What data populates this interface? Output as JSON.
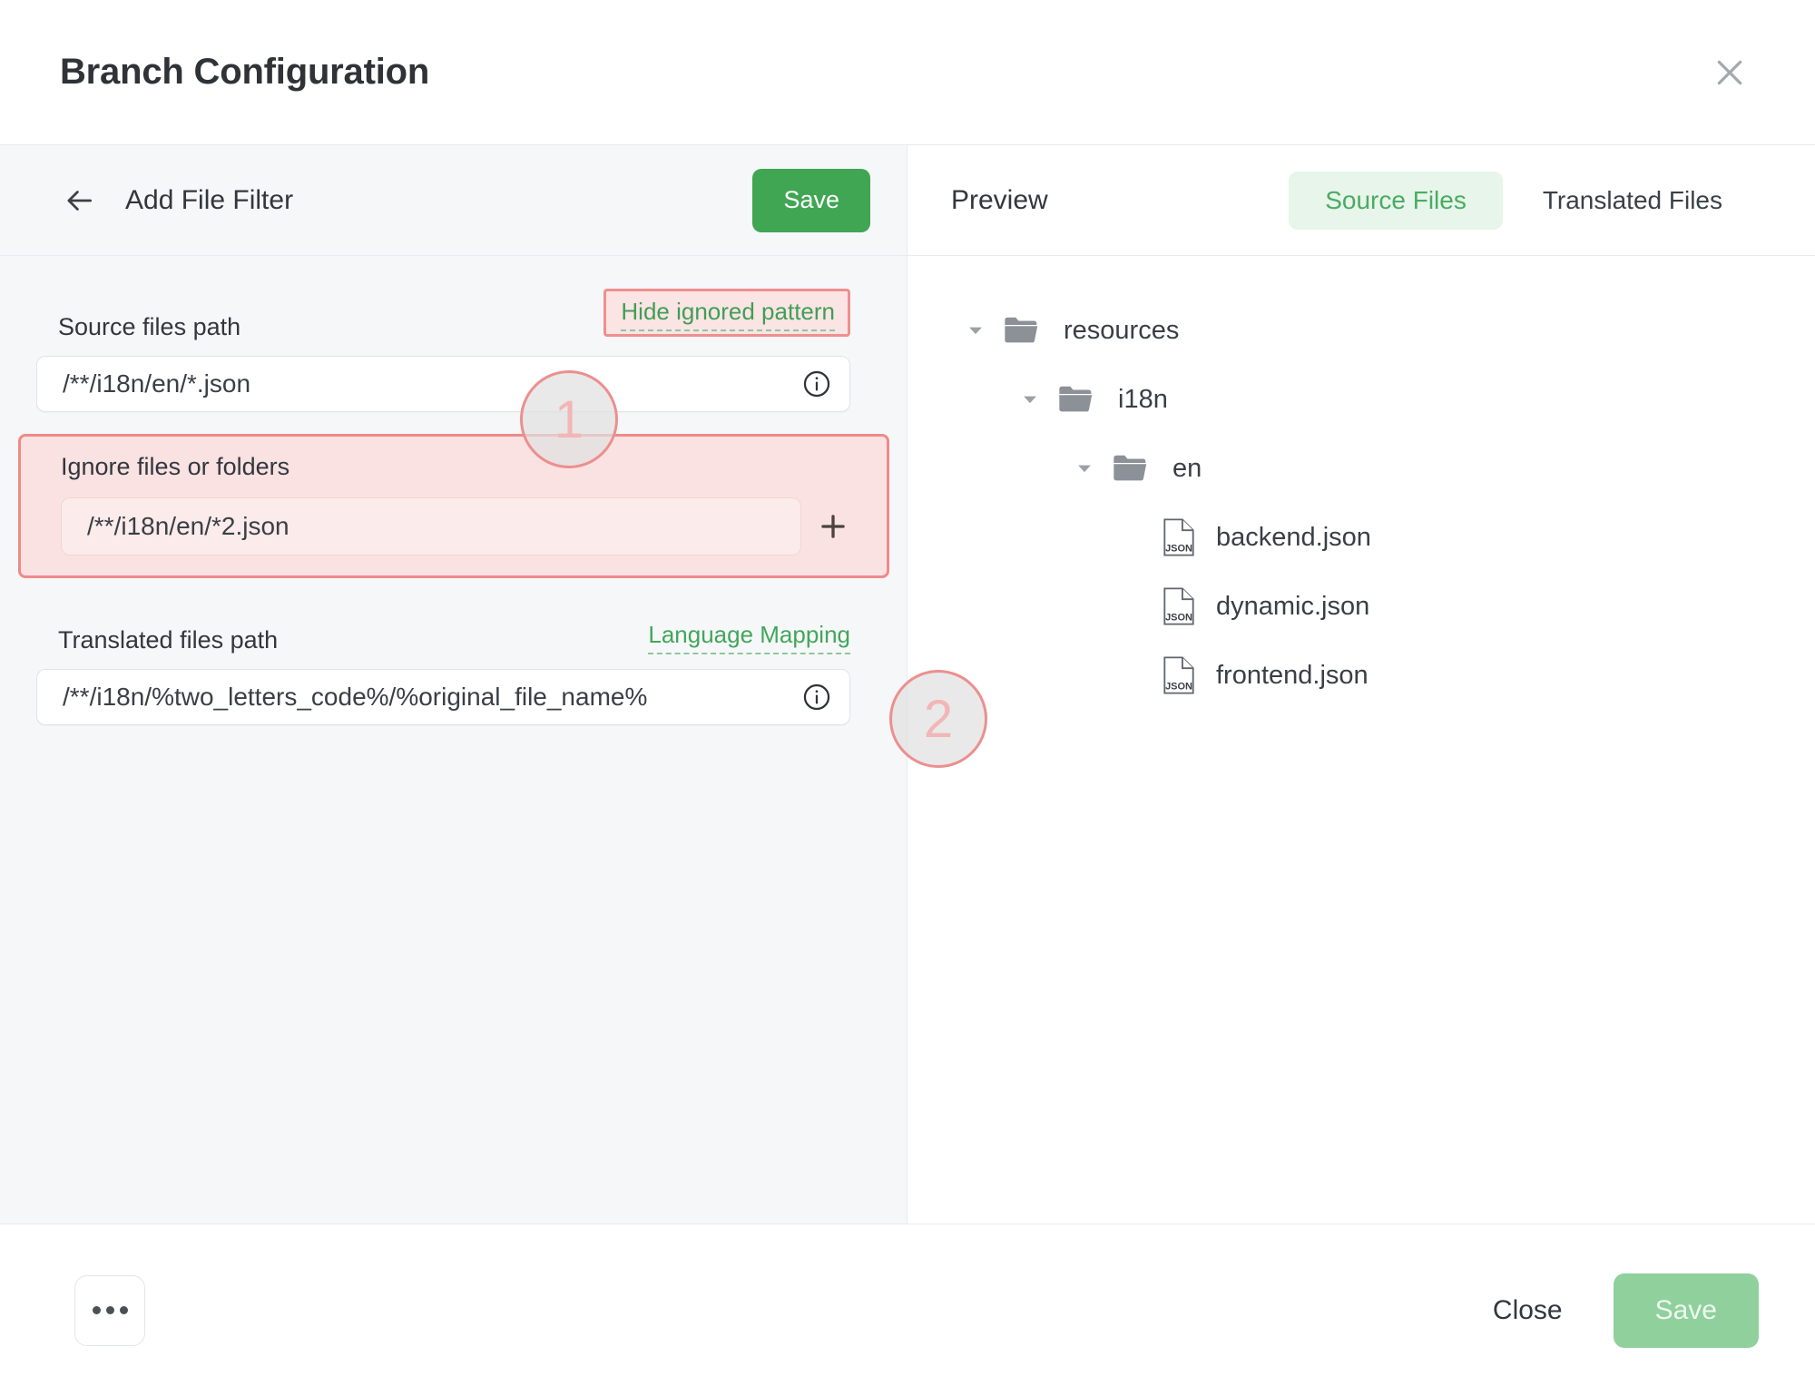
{
  "header": {
    "title": "Branch Configuration",
    "close_icon": "close-icon"
  },
  "left_panel": {
    "back_icon": "arrow-left-icon",
    "subtitle": "Add File Filter",
    "save_label": "Save",
    "source_files": {
      "label": "Source files path",
      "toggle_link": "Hide ignored pattern",
      "value": "/**/i18n/en/*.json",
      "info_icon": "info-icon"
    },
    "ignore": {
      "label": "Ignore files or folders",
      "value": "/**/i18n/en/*2.json",
      "add_icon": "plus-icon"
    },
    "translated_files": {
      "label": "Translated files path",
      "mapping_link": "Language Mapping",
      "value": "/**/i18n/%two_letters_code%/%original_file_name%",
      "info_icon": "info-icon"
    }
  },
  "right_panel": {
    "preview_title": "Preview",
    "tabs": [
      {
        "label": "Source Files",
        "active": true
      },
      {
        "label": "Translated Files",
        "active": false
      }
    ],
    "tree": [
      {
        "label": "resources",
        "type": "folder",
        "level": 0,
        "expanded": true
      },
      {
        "label": "i18n",
        "type": "folder",
        "level": 1,
        "expanded": true
      },
      {
        "label": "en",
        "type": "folder",
        "level": 2,
        "expanded": true
      },
      {
        "label": "backend.json",
        "type": "file",
        "level": 3,
        "badge": "JSON"
      },
      {
        "label": "dynamic.json",
        "type": "file",
        "level": 3,
        "badge": "JSON"
      },
      {
        "label": "frontend.json",
        "type": "file",
        "level": 3,
        "badge": "JSON"
      }
    ]
  },
  "footer": {
    "more_icon": "ellipsis-icon",
    "close_label": "Close",
    "save_label": "Save"
  },
  "annotations": [
    {
      "number": "1"
    },
    {
      "number": "2"
    }
  ],
  "colors": {
    "accent_green": "#40a653",
    "link_green": "#41a75a",
    "tab_active_bg": "#e7f5ea",
    "highlight_border": "#ef8a8a",
    "highlight_bg": "#fae2e2",
    "save_disabled": "#90d09c"
  }
}
